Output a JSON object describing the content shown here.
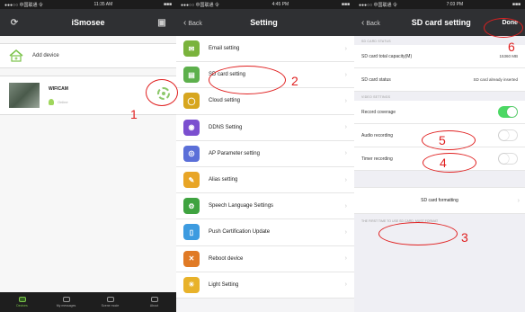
{
  "panel1": {
    "title": "iSmosee",
    "add_device": "Add device",
    "device": {
      "name": "WIFICAM",
      "status": "Online"
    },
    "tabs": [
      {
        "label": "Devices",
        "active": true
      },
      {
        "label": "My messages",
        "active": false
      },
      {
        "label": "Scene mode",
        "active": false
      },
      {
        "label": "About",
        "active": false
      }
    ]
  },
  "panel2": {
    "back": "Back",
    "title": "Setting",
    "items": [
      {
        "label": "Email setting",
        "color": "#7ab33c"
      },
      {
        "label": "SD card setting",
        "color": "#5db04c"
      },
      {
        "label": "Cloud setting",
        "color": "#d7a61f"
      },
      {
        "label": "DDNS Setting",
        "color": "#7b4fcf"
      },
      {
        "label": "AP Parameter setting",
        "color": "#5b6fd8"
      },
      {
        "label": "Alias setting",
        "color": "#e8a526"
      },
      {
        "label": "Speech Language Settings",
        "color": "#3fa340"
      },
      {
        "label": "Push Certification Update",
        "color": "#3d9be0"
      },
      {
        "label": "Reboot device",
        "color": "#e07a25"
      },
      {
        "label": "Light Setting",
        "color": "#e8b22a"
      }
    ]
  },
  "panel3": {
    "back": "Back",
    "title": "SD card setting",
    "done": "Done",
    "section1": "SD CARD STATUS",
    "capacity_label": "SD card total capacity(M)",
    "capacity_value": "15360 MB",
    "status_label": "SD card status",
    "status_value": "SD card already inserted",
    "section2": "VIDEO SETTINGS",
    "record_coverage": "Record coverage",
    "record_coverage_on": true,
    "audio_recording": "Audio recording",
    "audio_recording_on": false,
    "timer_recording": "Timer recording",
    "timer_recording_on": false,
    "format_label": "SD card formatting",
    "note": "THE FIRST TIME TO USE SD CARD, MUST FORMAT"
  },
  "annotations": [
    "1",
    "2",
    "3",
    "4",
    "5",
    "6"
  ],
  "status": {
    "left": "●●●○○ 中国联通 令",
    "time1": "11:35 AM",
    "time2": "4:45 PM",
    "time3": "7:03 PM",
    "battery": "■■■"
  }
}
